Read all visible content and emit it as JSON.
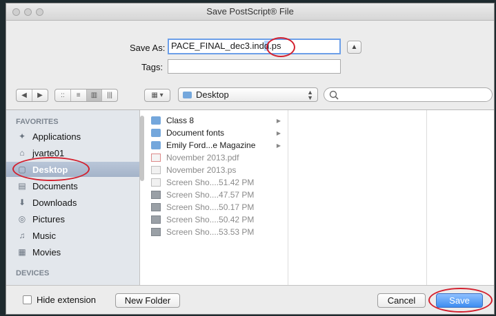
{
  "window": {
    "title": "Save PostScript® File"
  },
  "form": {
    "save_as_label": "Save As:",
    "filename_prefix": "PACE_FINAL_dec3.ind",
    "filename_selected": "d",
    "filename_suffix": ".ps",
    "tags_label": "Tags:",
    "tags_value": "",
    "expand_glyph": "▲"
  },
  "toolbar": {
    "back_glyph": "◀",
    "forward_glyph": "▶",
    "view_icons": [
      "::",
      "≡",
      "▥",
      "|||"
    ],
    "arrange_glyph": "▦ ▾",
    "location": "Desktop",
    "search_placeholder": ""
  },
  "sidebar": {
    "favorites_heading": "FAVORITES",
    "devices_heading": "DEVICES",
    "favorites": [
      {
        "label": "Applications",
        "icon": "✦"
      },
      {
        "label": "jvarte01",
        "icon": "⌂"
      },
      {
        "label": "Desktop",
        "icon": "▢",
        "selected": true
      },
      {
        "label": "Documents",
        "icon": "▤"
      },
      {
        "label": "Downloads",
        "icon": "⬇"
      },
      {
        "label": "Pictures",
        "icon": "◎"
      },
      {
        "label": "Music",
        "icon": "♫"
      },
      {
        "label": "Movies",
        "icon": "▦"
      }
    ]
  },
  "files": [
    {
      "name": "Class 8",
      "kind": "folder",
      "enabled": true,
      "chevron": true
    },
    {
      "name": "Document fonts",
      "kind": "folder",
      "enabled": true,
      "chevron": true
    },
    {
      "name": "Emily Ford...e Magazine",
      "kind": "folder",
      "enabled": true,
      "chevron": true
    },
    {
      "name": "November 2013.pdf",
      "kind": "pdf",
      "enabled": false
    },
    {
      "name": "November 2013.ps",
      "kind": "doc",
      "enabled": false
    },
    {
      "name": "Screen Sho....51.42 PM",
      "kind": "doc",
      "enabled": false
    },
    {
      "name": "Screen Sho....47.57 PM",
      "kind": "shot",
      "enabled": false
    },
    {
      "name": "Screen Sho....50.17 PM",
      "kind": "shot",
      "enabled": false
    },
    {
      "name": "Screen Sho....50.42 PM",
      "kind": "shot",
      "enabled": false
    },
    {
      "name": "Screen Sho....53.53 PM",
      "kind": "shot",
      "enabled": false
    }
  ],
  "footer": {
    "hide_extension_label": "Hide extension",
    "new_folder_label": "New Folder",
    "cancel_label": "Cancel",
    "save_label": "Save"
  },
  "colors": {
    "annotation": "#d3202e",
    "default_button": "#3d8df0",
    "selection": "#b5d5ff"
  }
}
